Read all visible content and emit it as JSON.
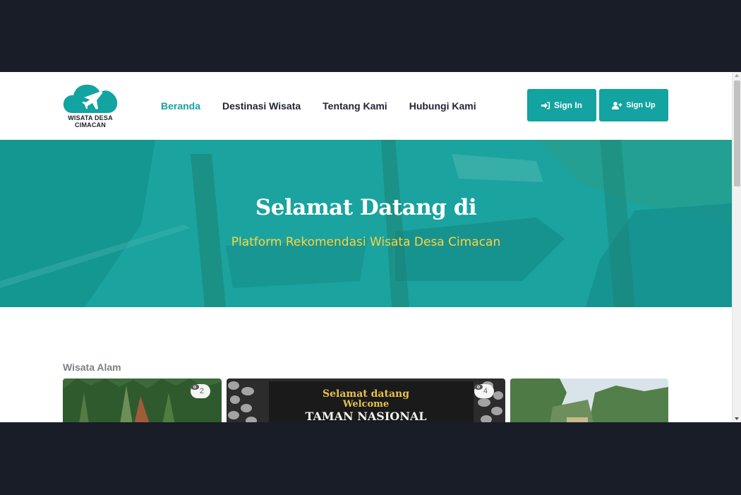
{
  "brand": {
    "name": "WISATA DESA CIMACAN"
  },
  "nav": {
    "items": [
      {
        "label": "Beranda",
        "active": true
      },
      {
        "label": "Destinasi Wisata",
        "active": false
      },
      {
        "label": "Tentang Kami",
        "active": false
      },
      {
        "label": "Hubungi Kami",
        "active": false
      }
    ],
    "signin_label": "Sign In",
    "signup_label": "Sign Up"
  },
  "hero": {
    "title": "Selamat Datang di",
    "subtitle": "Platform Rekomendasi Wisata Desa Cimacan"
  },
  "section": {
    "title": "Wisata Alam",
    "cards": [
      {
        "views": "2"
      },
      {
        "views": "4",
        "sign_line1": "Selamat datang",
        "sign_line2": "Welcome",
        "sign_line3": "TAMAN NASIONAL"
      },
      {
        "views": ""
      }
    ]
  },
  "colors": {
    "accent": "#13a3a0",
    "hero_sub": "#ffd43b",
    "dark_frame": "#181d27"
  },
  "icons": {
    "signin": "sign-in-icon",
    "signup": "user-plus-icon",
    "views": "eye-icon"
  }
}
